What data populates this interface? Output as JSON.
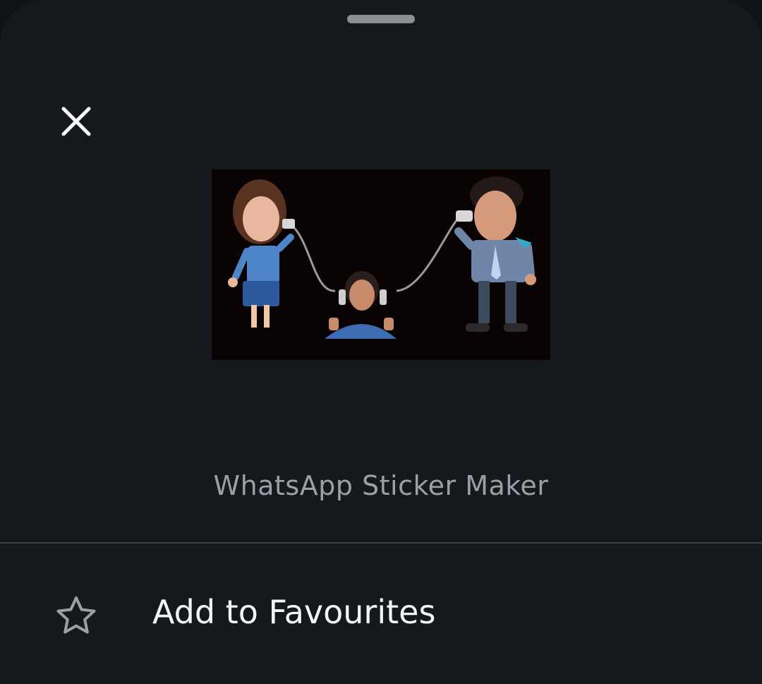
{
  "sheet": {
    "close_icon": "close-icon",
    "sticker_alt": "Sticker preview: three cartoon people with tin-can telephone",
    "app_label": "WhatsApp Sticker Maker"
  },
  "actions": {
    "favourite": {
      "icon": "star-outline-icon",
      "label": "Add to Favourites"
    }
  },
  "colors": {
    "background": "#15191d",
    "handle": "#8a8f94",
    "secondary_text": "#9aa0a5",
    "primary_text": "#f4f5f6",
    "divider": "#3a3f44"
  }
}
